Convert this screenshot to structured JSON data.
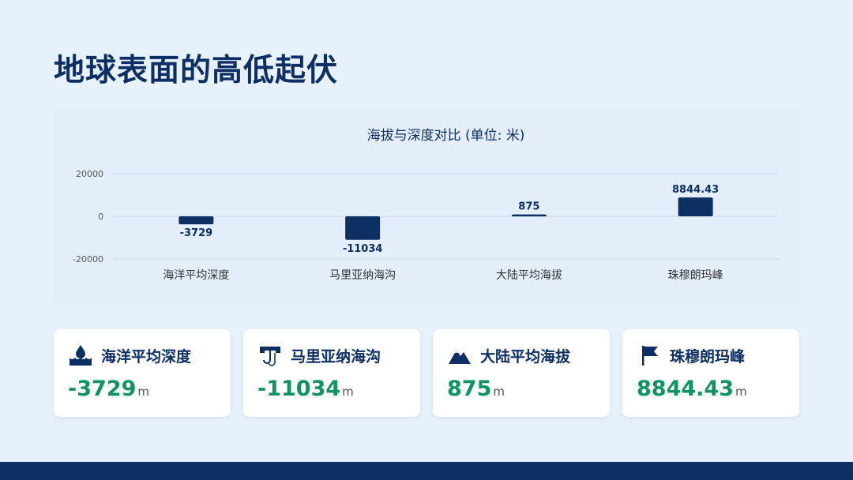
{
  "page": {
    "title": "地球表面的高低起伏"
  },
  "chart_data": {
    "type": "bar",
    "title": "海拔与深度对比 (单位: 米)",
    "categories": [
      "海洋平均深度",
      "马里亚纳海沟",
      "大陆平均海拔",
      "珠穆朗玛峰"
    ],
    "values": [
      -3729,
      -11034,
      875,
      8844.43
    ],
    "data_labels": [
      "-3729",
      "-11034",
      "875",
      "8844.43"
    ],
    "y_ticks": [
      20000,
      0,
      -20000
    ],
    "ylim": [
      -20000,
      20000
    ],
    "grid": true,
    "bar_color": "#0d2f63"
  },
  "cards": [
    {
      "label": "海洋平均深度",
      "value": "-3729",
      "unit": "m",
      "icon": "water-drop-icon"
    },
    {
      "label": "马里亚纳海沟",
      "value": "-11034",
      "unit": "m",
      "icon": "trench-hook-icon"
    },
    {
      "label": "大陆平均海拔",
      "value": "875",
      "unit": "m",
      "icon": "mountain-icon"
    },
    {
      "label": "珠穆朗玛峰",
      "value": "8844.43",
      "unit": "m",
      "icon": "flag-icon"
    }
  ],
  "colors": {
    "accent": "#0d2f63",
    "value_green": "#0e9460",
    "background": "#e7f1fc"
  }
}
